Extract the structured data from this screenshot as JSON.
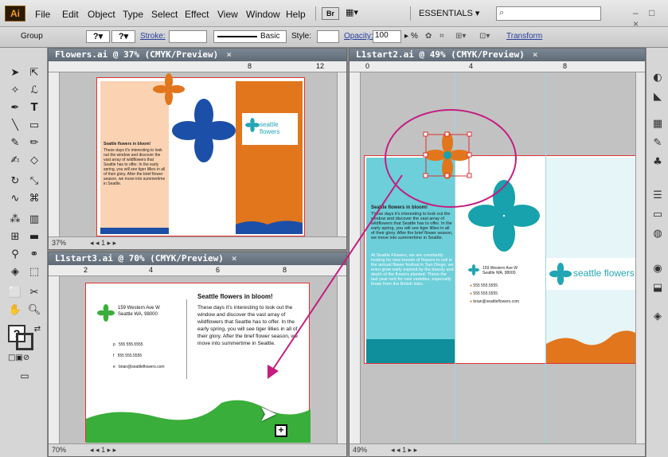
{
  "app": {
    "logo": "Ai",
    "menus": [
      "File",
      "Edit",
      "Object",
      "Type",
      "Select",
      "Effect",
      "View",
      "Window",
      "Help"
    ],
    "bridge": "Br",
    "workspace": "ESSENTIALS ▾",
    "search_placeholder": "",
    "window_buttons": "– □ ×"
  },
  "control": {
    "selection": "Group",
    "stroke_label": "Stroke:",
    "brush": "Basic",
    "style_label": "Style:",
    "opacity_label": "Opacity:",
    "opacity_value": "100",
    "percent": "%",
    "transform_label": "Transform"
  },
  "docs": [
    {
      "title": "Flowers.ai @ 37% (CMYK/Preview)",
      "close": "×",
      "zoom": "37%",
      "page": "1",
      "ruler": [
        "8",
        "12"
      ]
    },
    {
      "title": "L1start3.ai @ 70% (CMYK/Preview)",
      "close": "×",
      "zoom": "70%",
      "page": "1",
      "ruler": [
        "2",
        "4",
        "6",
        "8"
      ]
    },
    {
      "title": "L1start2.ai @ 49% (CMYK/Preview)",
      "close": "×",
      "zoom": "49%",
      "page": "1",
      "ruler": [
        "0",
        "4",
        "8"
      ]
    }
  ],
  "brochure": {
    "heading": "Seattle flowers in bloom!",
    "body": "These days it's interesting to look out the window and discover the vast array of wildflowers that Seattle has to offer. In the early spring, you will see tiger lillies in all of their glory. After the brief flower season, we move into summertime in Seattle.",
    "body2": "At Seattle Flowers, we are constantly looking for new breeds of flowers to sell in the annual flower festival in San Diego, we even grow early expired by the beauty and depth of the flowers planted. These the last year rent for new varieties, especially those from the British Isles.",
    "brand": "seattle flowers",
    "address1": "159 Western Ave W",
    "address2": "Seattle WA, 98000",
    "phone": "555 555.5555",
    "fax": "555 555.5555",
    "email": "brian@seattleflowers.com",
    "p": "p",
    "f": "f",
    "e": "e"
  },
  "colors": {
    "orange": "#e2761c",
    "teal": "#3bbcc9",
    "blue": "#1b4fa8",
    "green": "#3aae3a",
    "magenta": "#c41d7f",
    "peach": "#fbd3b3"
  }
}
